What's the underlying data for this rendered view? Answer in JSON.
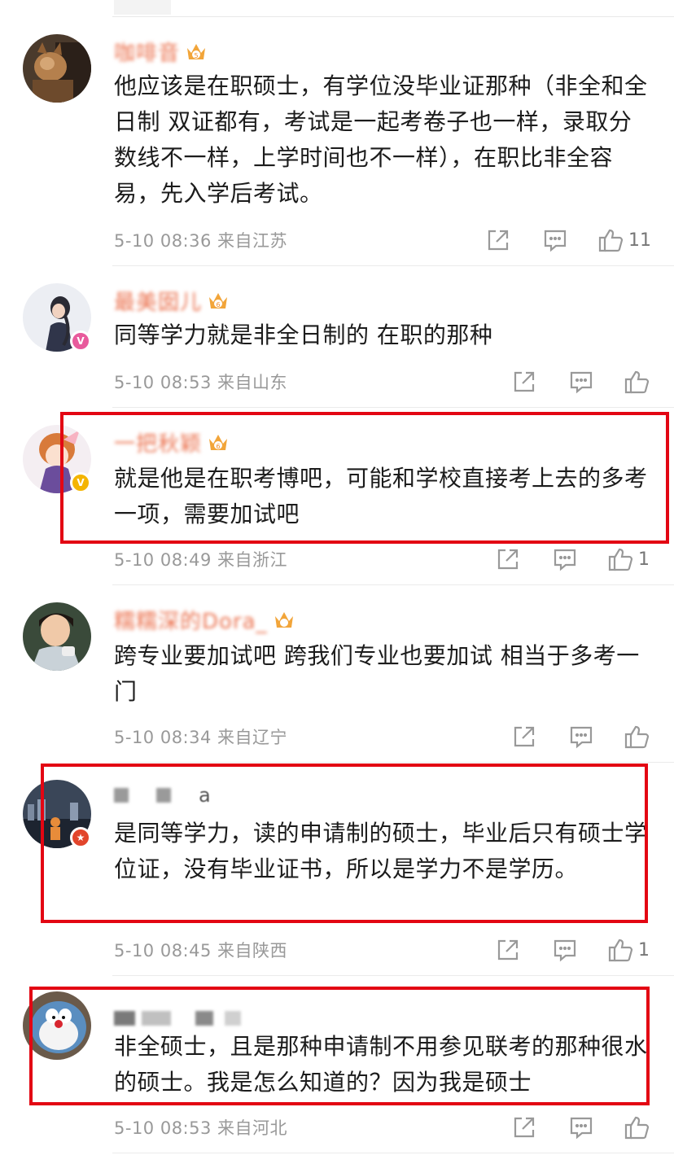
{
  "comments": [
    {
      "name": "咖啡音",
      "level": "5",
      "text": "他应该是在职硕士，有学位没毕业证那种（非全和全日制 双证都有，考试是一起考卷子也一样，录取分数线不一样，上学时间也不一样），在职比非全容易，先入学后考试。",
      "time": "5-10 08:36",
      "location": "来自江苏",
      "likes": "11"
    },
    {
      "name": "最美囡儿",
      "level": "6",
      "text": "同等学力就是非全日制的 在职的那种",
      "time": "5-10 08:53",
      "location": "来自山东",
      "likes": ""
    },
    {
      "name": "一把秋颖",
      "level": "6",
      "text": "就是他是在职考博吧，可能和学校直接考上去的多考一项，需要加试吧",
      "time": "5-10 08:49",
      "location": "来自浙江",
      "likes": "1"
    },
    {
      "name": "糯糯深的Dora_",
      "level": "",
      "text": "跨专业要加试吧 跨我们专业也要加试 相当于多考一门",
      "time": "5-10 08:34",
      "location": "来自辽宁",
      "likes": ""
    },
    {
      "name": "a",
      "level": "",
      "text": "是同等学力，读的申请制的硕士，毕业后只有硕士学位证，没有毕业证书，所以是学力不是学历。",
      "time": "5-10 08:45",
      "location": "来自陕西",
      "likes": "1"
    },
    {
      "name": "",
      "level": "",
      "text": "非全硕士，且是那种申请制不用参见联考的那种很水的硕士。我是怎么知道的？因为我是硕士",
      "time": "5-10 08:53",
      "location": "来自河北",
      "likes": ""
    }
  ],
  "icons": {
    "share": "share-icon",
    "reply": "comment-icon",
    "like": "thumbs-up-icon"
  },
  "colors": {
    "username": "#eb7350",
    "highlight_box": "#e30613",
    "meta_text": "#999999"
  }
}
